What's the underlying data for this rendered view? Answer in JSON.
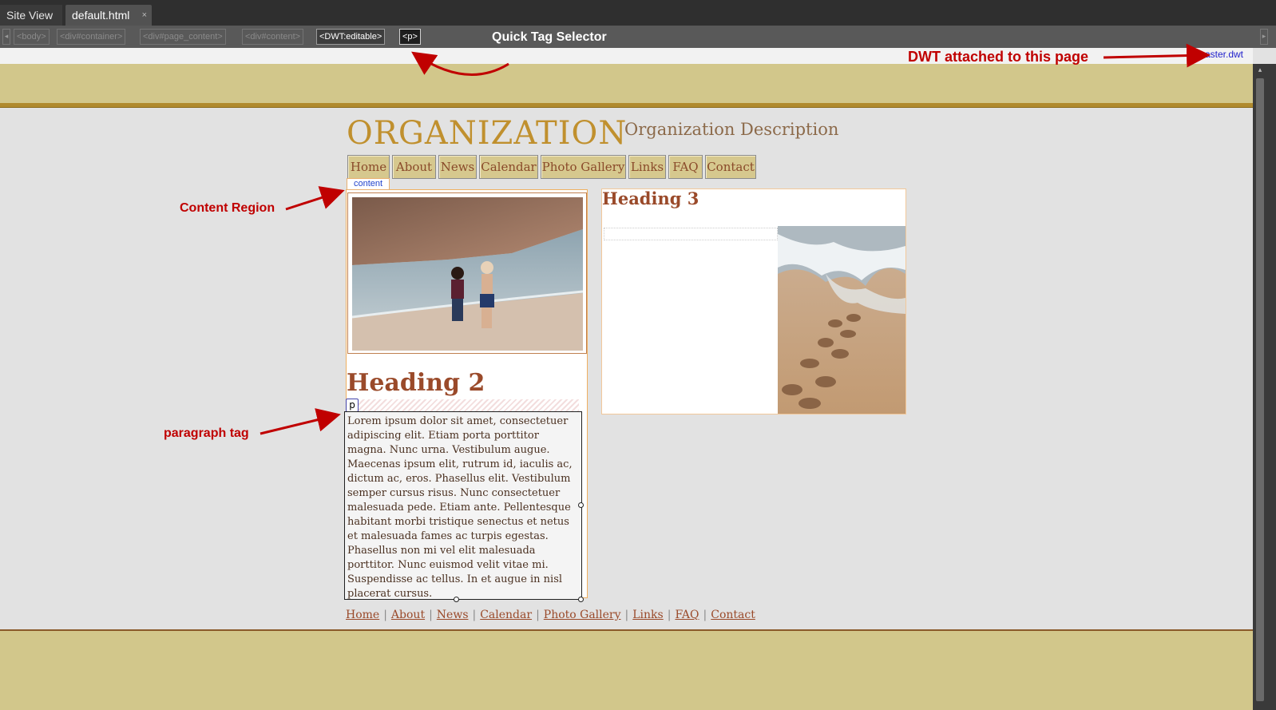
{
  "tabs": {
    "site_view": "Site View",
    "document": "default.html",
    "close_glyph": "×"
  },
  "tag_selector": {
    "tags": [
      "<body>",
      "<div#container>",
      "<div#page_content>",
      "<div#content>",
      "<DWT:editable>",
      "<p>"
    ],
    "selected_tag": "<p>",
    "label": "Quick Tag Selector"
  },
  "dwt": {
    "annotation": "DWT attached to this page",
    "template_link": "master.dwt"
  },
  "page": {
    "org_title": "ORGANIZATION",
    "org_description": "Organization Description",
    "nav": [
      "Home",
      "About",
      "News",
      "Calendar",
      "Photo Gallery",
      "Links",
      "FAQ",
      "Contact"
    ],
    "content_region_label": "content",
    "heading2": "Heading 2",
    "p_tag_label": "p",
    "paragraph": "Lorem ipsum dolor sit amet, consectetuer adipiscing elit. Etiam porta porttitor magna. Nunc urna. Vestibulum augue. Maecenas ipsum elit, rutrum id, iaculis ac, dictum ac, eros. Phasellus elit. Vestibulum semper cursus risus. Nunc consectetuer malesuada pede. Etiam ante. Pellentesque habitant morbi tristique senectus et netus et malesuada fames ac turpis egestas. Phasellus non mi vel elit malesuada porttitor. Nunc euismod velit vitae mi. Suspendisse ac tellus. In et augue in nisl placerat cursus.",
    "heading3": "Heading 3",
    "footer_links": [
      "Home",
      "About",
      "News",
      "Calendar",
      "Photo Gallery",
      "Links",
      "FAQ",
      "Contact"
    ],
    "footer_separator": "|"
  },
  "annotations": {
    "content_region": "Content Region",
    "paragraph_tag": "paragraph tag"
  },
  "colors": {
    "band": "#d2c78b",
    "title_gold": "#c0902e",
    "heading_brown": "#9a4a2a",
    "annotation_red": "#c00000"
  },
  "icons": {
    "photo_children_beach": "photo-children-beach",
    "photo_footprints_sand": "photo-footprints-sand"
  }
}
